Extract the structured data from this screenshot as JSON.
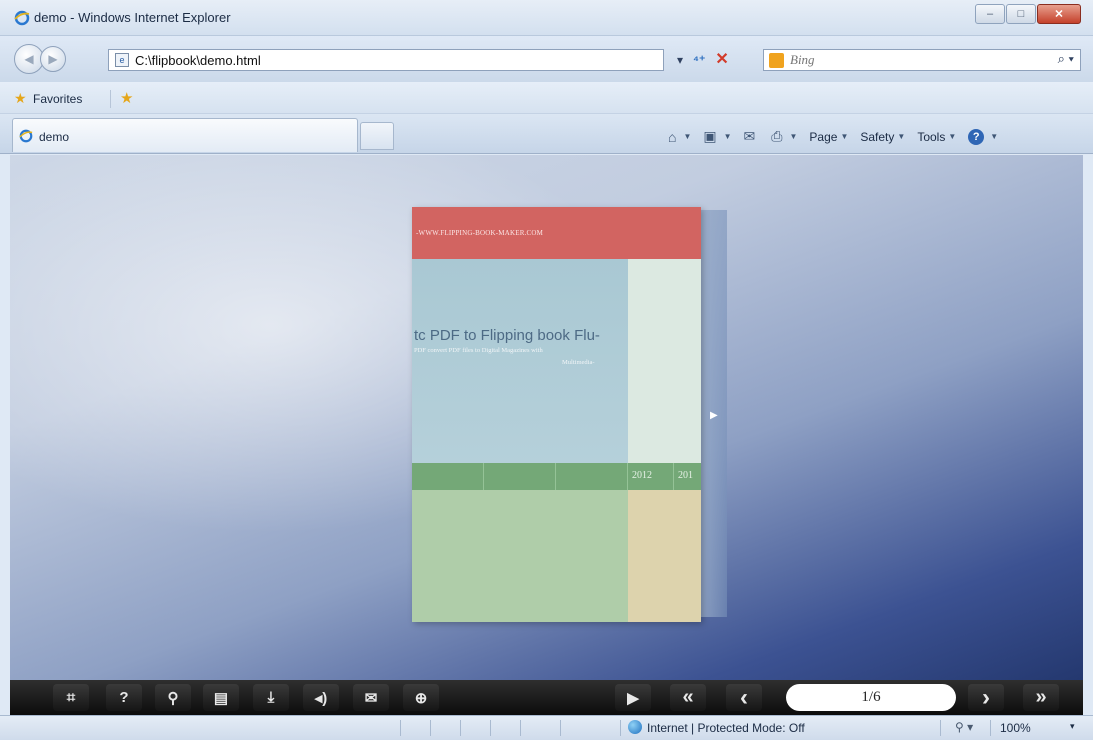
{
  "window": {
    "title": "demo - Windows Internet Explorer",
    "controls": {
      "minimize": "–",
      "maximize": "□",
      "close": "✕"
    }
  },
  "address": {
    "url": "C:\\flipbook\\demo.html",
    "compat_caret": "▾",
    "refresh": "⁴⁺",
    "stop": "✕"
  },
  "search": {
    "placeholder": "Bing",
    "go": "⌕ ▾"
  },
  "favorites": {
    "label": "Favorites"
  },
  "tab": {
    "label": "demo"
  },
  "command_bar": {
    "items": [
      {
        "icon": "home-icon",
        "glyph": "⌂",
        "label": ""
      },
      {
        "icon": "feeds-icon",
        "glyph": "▣",
        "label": ""
      },
      {
        "icon": "mail-icon",
        "glyph": "✉",
        "label": ""
      },
      {
        "icon": "print-icon",
        "glyph": "⎙",
        "label": ""
      },
      {
        "icon": "page-icon",
        "glyph": "",
        "label": "Page"
      },
      {
        "icon": "safety-icon",
        "glyph": "",
        "label": "Safety"
      },
      {
        "icon": "tools-icon",
        "glyph": "",
        "label": "Tools"
      },
      {
        "icon": "help-icon",
        "glyph": "?",
        "label": ""
      }
    ]
  },
  "book": {
    "header_url": "-WWW.FLIPPING-BOOK-MAKER.COM",
    "cover_title": "tc PDF to Flipping book Flu-",
    "cover_sub1": "PDF convert PDF files to Digital Magazines with",
    "cover_sub2": "Multimedia-",
    "years": [
      "2012",
      "201"
    ]
  },
  "flipbook_toolbar": {
    "left_buttons": [
      {
        "name": "fullscreen-button",
        "glyph": "⌗"
      },
      {
        "name": "help-button",
        "glyph": "?"
      },
      {
        "name": "search-button",
        "glyph": "⚲"
      },
      {
        "name": "print-button",
        "glyph": "▤"
      },
      {
        "name": "download-button",
        "glyph": "⤓"
      },
      {
        "name": "sound-button",
        "glyph": "◂)"
      },
      {
        "name": "email-button",
        "glyph": "✉"
      },
      {
        "name": "zoom-button",
        "glyph": "⊕"
      }
    ],
    "play": "▶",
    "first": "«",
    "prev": "‹",
    "page_indicator": "1/6",
    "next": "›",
    "last": "»"
  },
  "status": {
    "zone": "Internet | Protected Mode: Off",
    "zoom": "100%",
    "zoom_caret": "▾"
  },
  "colors": {
    "book_header": "#d26461",
    "book_band": "#74a877",
    "toolbar_bg": "#1a1a1a"
  }
}
